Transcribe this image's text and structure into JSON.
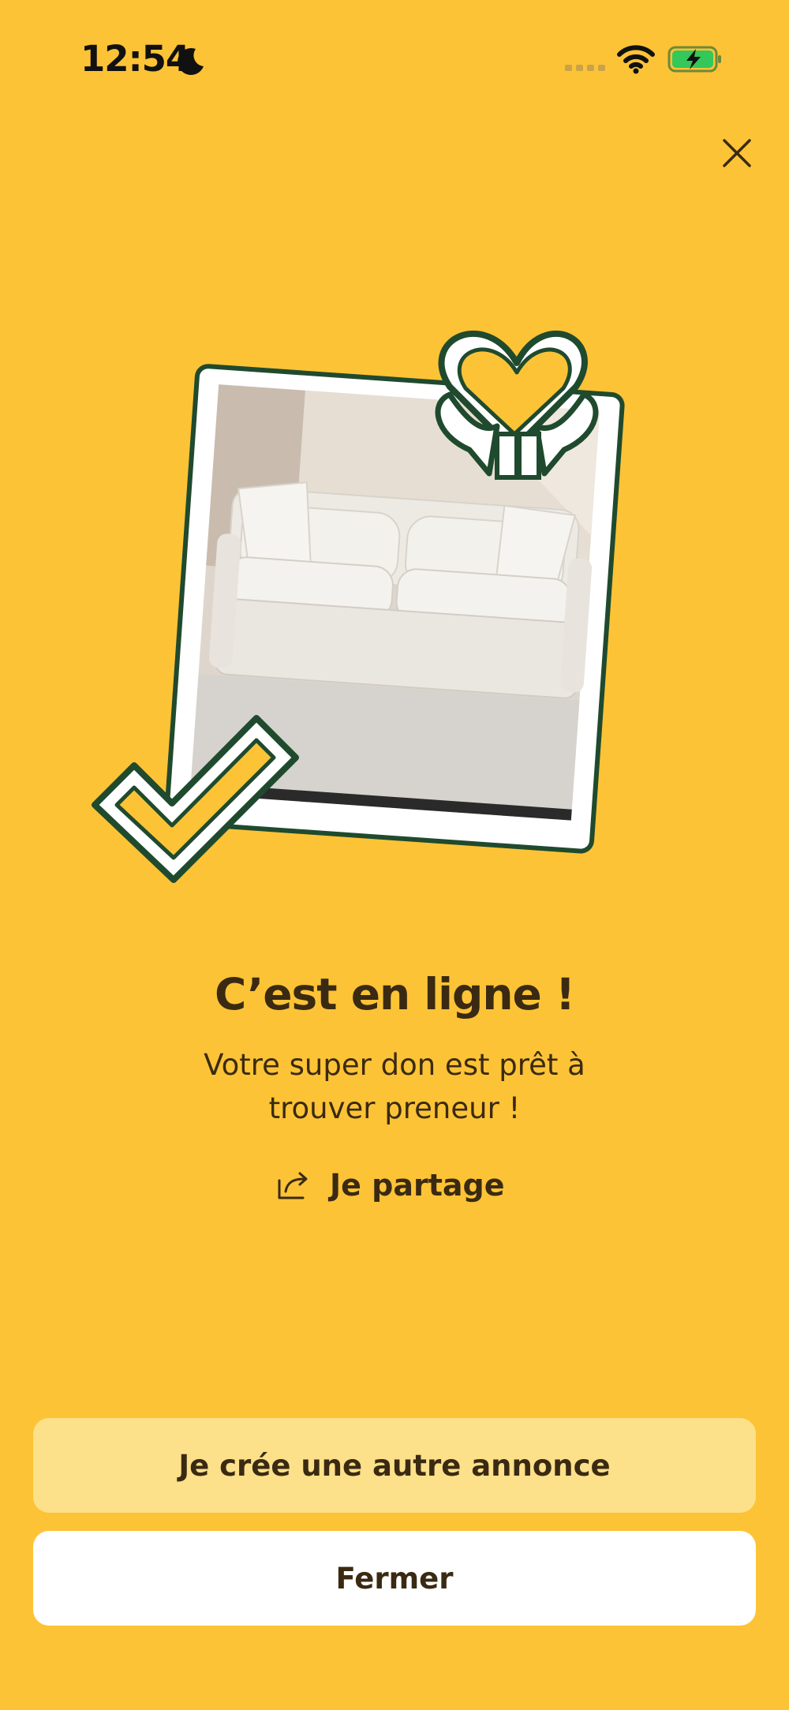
{
  "status_bar": {
    "time": "12:54",
    "icons": [
      "moon-icon",
      "cellular-signal-icon",
      "wifi-icon",
      "battery-charging-icon"
    ],
    "battery_color": "#34C759"
  },
  "close": {
    "icon": "close-icon"
  },
  "hero": {
    "image": "white-sofa-photo",
    "stickers": [
      "heart-hands-icon",
      "checkmark-icon"
    ]
  },
  "confirmation": {
    "title": "C’est en ligne !",
    "subtitle": "Votre super don est prêt à trouver preneur !",
    "share_label": "Je partage",
    "share_icon": "share-icon"
  },
  "actions": {
    "create_another_label": "Je crée une autre annonce",
    "close_label": "Fermer"
  },
  "colors": {
    "background": "#FDC336",
    "secondary_button": "#FDE08A",
    "primary_button": "#FFFFFF",
    "text": "#3A2A12",
    "outline": "#1F4A2E"
  }
}
